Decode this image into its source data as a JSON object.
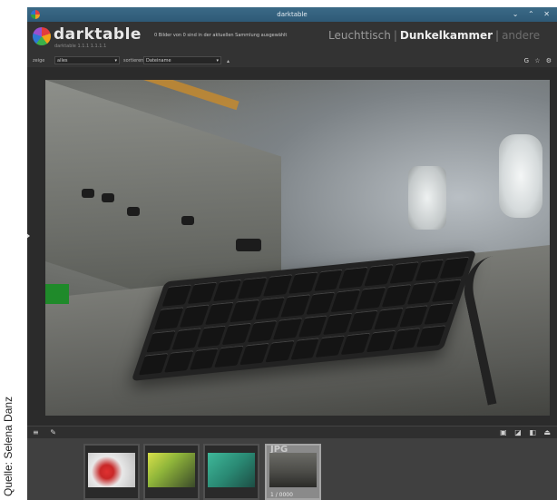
{
  "window": {
    "title": "darktable"
  },
  "app": {
    "name": "darktable",
    "version": "darktable 1.1.1 1.1.1.1"
  },
  "collection_info": "0 Bilder von 0 sind in der aktuellen Sammlung ausgewählt",
  "views": {
    "lighttable": "Leuchttisch",
    "separator": "|",
    "darkroom": "Dunkelkammer",
    "other": "andere"
  },
  "filter": {
    "show_label": "zeige",
    "show_value": "alles",
    "sort_label": "sortieren nach",
    "sort_value": "Dateiname"
  },
  "header_icons": "G ☆ ⚙",
  "filmstrip": {
    "thumbs": [
      {
        "caption": "",
        "ext": ""
      },
      {
        "caption": "",
        "ext": ""
      },
      {
        "caption": "",
        "ext": ""
      },
      {
        "caption": "1 / 0000",
        "ext": "JPG"
      }
    ]
  },
  "credit": "Quelle: Selena Danz",
  "colors": {
    "titlebar": "#2e5a77",
    "panel_bg": "#333333",
    "center_bg": "#2b2b2b"
  }
}
